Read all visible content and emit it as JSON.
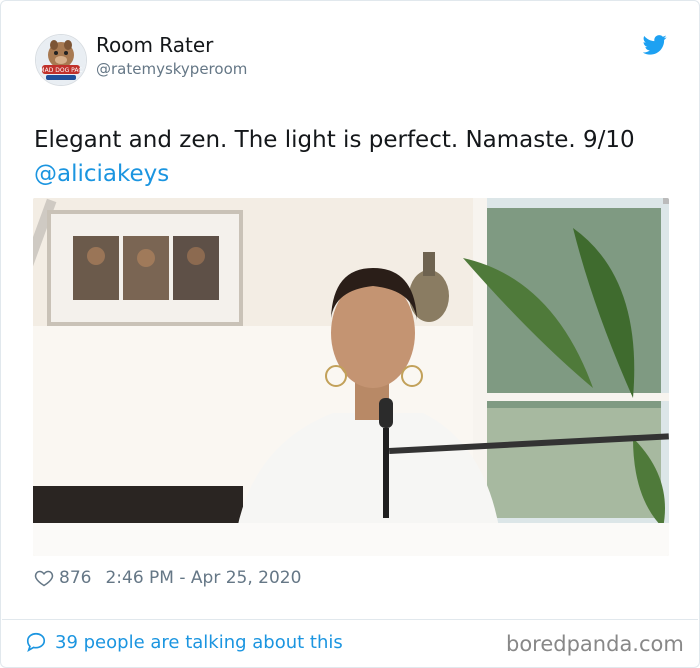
{
  "tweet": {
    "display_name": "Room Rater",
    "handle": "@ratemyskyperoom",
    "text": "Elegant and zen. The light is perfect. Namaste. 9/10",
    "mention": "@aliciakeys",
    "likes": "876",
    "timestamp": "2:46 PM - Apr 25, 2020",
    "talking": "39 people are talking about this"
  },
  "avatar": {
    "badge_text": "MAD DOG PAC"
  },
  "watermark": "boredpanda.com",
  "icons": {
    "brand": "twitter-bird-icon",
    "like": "heart-icon",
    "reply": "speech-bubble-icon"
  },
  "colors": {
    "accent": "#1b95e0",
    "muted": "#657786",
    "text": "#14171a",
    "border": "#e1e8ed"
  }
}
